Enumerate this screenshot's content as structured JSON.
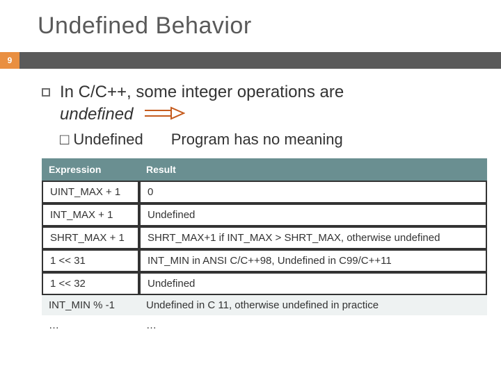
{
  "title": "Undefined Behavior",
  "page_number": "9",
  "bullet": {
    "lead_a": "In C/C++, some integer operations are",
    "lead_b_italic": "undefined",
    "sub_marker": "□",
    "sub_label": "Undefined",
    "meaning": "Program has no meaning"
  },
  "table": {
    "headers": {
      "expr": "Expression",
      "result": "Result"
    },
    "rows": [
      {
        "expr": "UINT_MAX + 1",
        "result": "0"
      },
      {
        "expr": "INT_MAX + 1",
        "result": "Undefined"
      },
      {
        "expr": "SHRT_MAX + 1",
        "result": "SHRT_MAX+1 if INT_MAX > SHRT_MAX, otherwise undefined"
      },
      {
        "expr": "1 << 31",
        "result": "INT_MIN in ANSI C/C++98, Undefined in C99/C++11"
      },
      {
        "expr": "1 << 32",
        "result": "Undefined"
      },
      {
        "expr": "INT_MIN % -1",
        "result": "Undefined in C 11, otherwise undefined in practice"
      },
      {
        "expr": "…",
        "result": "…"
      }
    ]
  }
}
